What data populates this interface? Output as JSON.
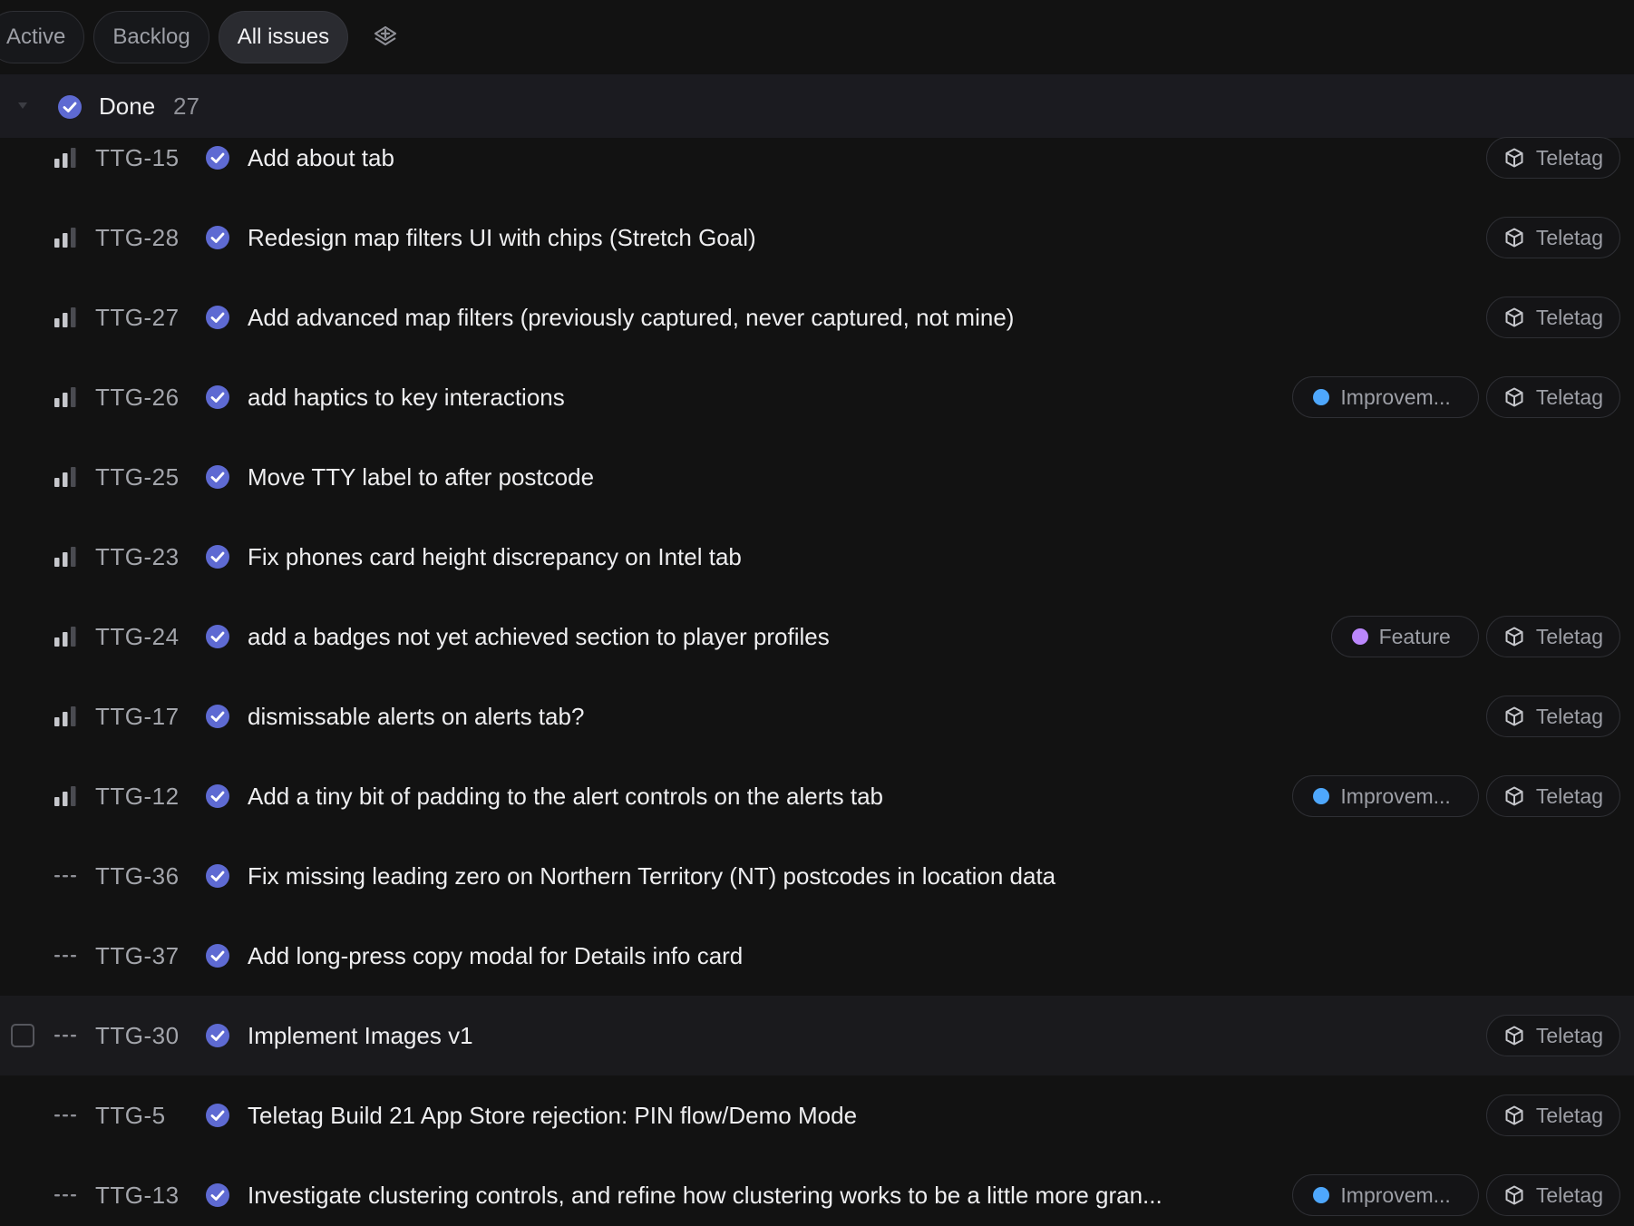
{
  "tabs": [
    {
      "label": "Active"
    },
    {
      "label": "Backlog"
    },
    {
      "label": "All issues"
    }
  ],
  "group": {
    "title": "Done",
    "count": "27"
  },
  "colors": {
    "status_done": "#5e6ad2",
    "improvement": "#4ea7fc",
    "feature": "#bb87fc"
  },
  "rows": [
    {
      "id": "TTG-15",
      "priority": "medium",
      "title": "Add about tab",
      "labels": [],
      "project": "Teletag"
    },
    {
      "id": "TTG-28",
      "priority": "medium",
      "title": "Redesign map filters UI with chips (Stretch Goal)",
      "labels": [],
      "project": "Teletag"
    },
    {
      "id": "TTG-27",
      "priority": "medium",
      "title": "Add advanced map filters (previously captured, never captured, not mine)",
      "labels": [],
      "project": "Teletag"
    },
    {
      "id": "TTG-26",
      "priority": "medium",
      "title": "add haptics to key interactions",
      "labels": [
        {
          "name": "Improvem...",
          "color": "#4ea7fc"
        }
      ],
      "project": "Teletag"
    },
    {
      "id": "TTG-25",
      "priority": "medium",
      "title": "Move TTY label to after postcode",
      "labels": [],
      "project": ""
    },
    {
      "id": "TTG-23",
      "priority": "medium",
      "title": "Fix phones card height discrepancy on Intel tab",
      "labels": [],
      "project": ""
    },
    {
      "id": "TTG-24",
      "priority": "medium",
      "title": "add a badges not yet achieved section to player profiles",
      "labels": [
        {
          "name": "Feature",
          "color": "#bb87fc"
        }
      ],
      "project": "Teletag"
    },
    {
      "id": "TTG-17",
      "priority": "medium",
      "title": "dismissable alerts on alerts tab?",
      "labels": [],
      "project": "Teletag"
    },
    {
      "id": "TTG-12",
      "priority": "medium",
      "title": "Add a tiny bit of padding to the alert controls on the alerts tab",
      "labels": [
        {
          "name": "Improvem...",
          "color": "#4ea7fc"
        }
      ],
      "project": "Teletag"
    },
    {
      "id": "TTG-36",
      "priority": "none",
      "title": "Fix missing leading zero on Northern Territory (NT) postcodes in location data",
      "labels": [],
      "project": ""
    },
    {
      "id": "TTG-37",
      "priority": "none",
      "title": "Add long-press copy modal for Details info card",
      "labels": [],
      "project": ""
    },
    {
      "id": "TTG-30",
      "priority": "none",
      "title": "Implement Images v1",
      "labels": [],
      "project": "Teletag",
      "hover": true
    },
    {
      "id": "TTG-5",
      "priority": "none",
      "title": "Teletag Build 21 App Store rejection: PIN flow/Demo Mode",
      "labels": [],
      "project": "Teletag"
    },
    {
      "id": "TTG-13",
      "priority": "none",
      "title": "Investigate clustering controls, and refine how clustering works to be a little more gran...",
      "labels": [
        {
          "name": "Improvem...",
          "color": "#4ea7fc"
        }
      ],
      "project": "Teletag"
    }
  ]
}
